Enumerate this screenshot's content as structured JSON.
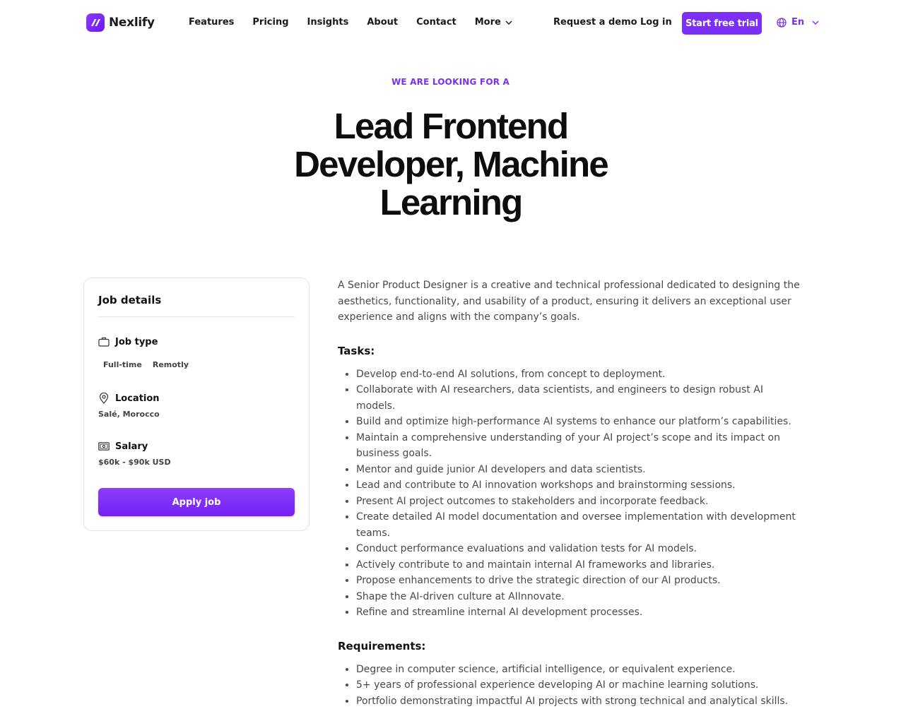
{
  "brand": {
    "name": "Nexlify",
    "accent": "#7b2ff7"
  },
  "nav": {
    "items": [
      "Features",
      "Pricing",
      "Insights",
      "About",
      "Contact"
    ],
    "more_label": "More"
  },
  "header_actions": {
    "demo_label": "Request a demo",
    "login_label": "Log in",
    "trial_label": "Start free trial",
    "language": "En"
  },
  "hero": {
    "eyebrow": "WE ARE LOOKING FOR A",
    "title": "Lead Frontend Developer, Machine Learning"
  },
  "job_details": {
    "title": "Job details",
    "job_type": {
      "label": "Job type",
      "values": [
        "Full-time",
        "Remotly"
      ]
    },
    "location": {
      "label": "Location",
      "value": "Salé, Morocco"
    },
    "salary": {
      "label": "Salary",
      "value": "$60k - $90k USD"
    },
    "apply_label": "Apply job"
  },
  "description": "A Senior Product Designer is a creative and technical professional dedicated to designing the aesthetics, functionality, and usability of a product, ensuring it delivers an exceptional user experience and aligns with the company’s goals.",
  "tasks": {
    "heading": "Tasks:",
    "items": [
      "Develop end-to-end AI solutions, from concept to deployment.",
      "Collaborate with AI researchers, data scientists, and engineers to design robust AI models.",
      "Build and optimize high-performance AI systems to enhance our platform’s capabilities.",
      "Maintain a comprehensive understanding of your AI project’s scope and its impact on business goals.",
      "Mentor and guide junior AI developers and data scientists.",
      "Lead and contribute to AI innovation workshops and brainstorming sessions.",
      "Present AI project outcomes to stakeholders and incorporate feedback.",
      "Create detailed AI model documentation and oversee implementation with development teams.",
      "Conduct performance evaluations and validation tests for AI models.",
      "Actively contribute to and maintain internal AI frameworks and libraries.",
      "Propose enhancements to drive the strategic direction of our AI products.",
      "Shape the AI-driven culture at AIInnovate.",
      "Refine and streamline internal AI development processes."
    ]
  },
  "requirements": {
    "heading": "Requirements:",
    "items": [
      "Degree in computer science, artificial intelligence, or equivalent experience.",
      "5+ years of professional experience developing AI or machine learning solutions.",
      "Portfolio demonstrating impactful AI projects with strong technical and analytical skills."
    ]
  }
}
